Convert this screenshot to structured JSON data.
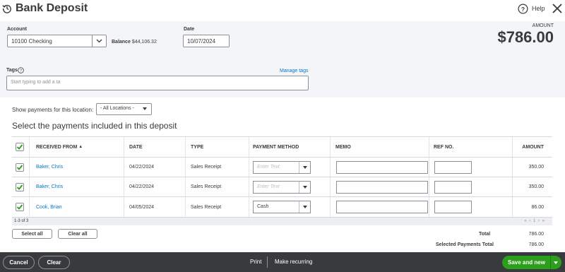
{
  "header": {
    "title": "Bank Deposit",
    "help_label": "Help"
  },
  "form": {
    "account_label": "Account",
    "account_value": "10100 Checking",
    "balance_label": "Balance",
    "balance_value": "$44,106.32",
    "date_label": "Date",
    "date_value": "10/07/2024",
    "amount_label": "AMOUNT",
    "amount_value": "$786.00",
    "tags_label": "Tags",
    "manage_tags": "Manage tags",
    "tags_placeholder": "Start typing to add a ta"
  },
  "payments": {
    "location_label": "Show payments for this location:",
    "location_value": "- All Locations -",
    "section_title": "Select the payments included in this deposit",
    "columns": [
      "RECEIVED FROM",
      "DATE",
      "TYPE",
      "PAYMENT METHOD",
      "MEMO",
      "REF NO.",
      "AMOUNT"
    ],
    "sort_indicator": "▲",
    "rows": [
      {
        "received_from": "Baker, Chris",
        "date": "04/22/2024",
        "type": "Sales Receipt",
        "payment_method": "",
        "payment_placeholder": "Enter Text",
        "memo": "",
        "ref_no": "",
        "amount": "350.00",
        "checked": true
      },
      {
        "received_from": "Baker, Chris",
        "date": "04/22/2024",
        "type": "Sales Receipt",
        "payment_method": "",
        "payment_placeholder": "Enter Text",
        "memo": "",
        "ref_no": "",
        "amount": "350.00",
        "checked": true
      },
      {
        "received_from": "Cook, Brian",
        "date": "04/05/2024",
        "type": "Sales Receipt",
        "payment_method": "Cash",
        "payment_placeholder": "",
        "memo": "",
        "ref_no": "",
        "amount": "86.00",
        "checked": true
      }
    ],
    "record_count": "1-3 of 3",
    "pager": "« ‹ 1 › »",
    "select_all": "Select all",
    "clear_all": "Clear all",
    "total_label": "Total",
    "total_value": "786.00",
    "selected_total_label": "Selected Payments Total",
    "selected_total_value": "786.00"
  },
  "bottom_bar": {
    "cancel": "Cancel",
    "clear": "Clear",
    "print": "Print",
    "make_recurring": "Make recurring",
    "save_and_new": "Save and new"
  },
  "colors": {
    "accent_green": "#2ca01c",
    "link_blue": "#0077c5",
    "bar_dark": "#393a3d"
  }
}
